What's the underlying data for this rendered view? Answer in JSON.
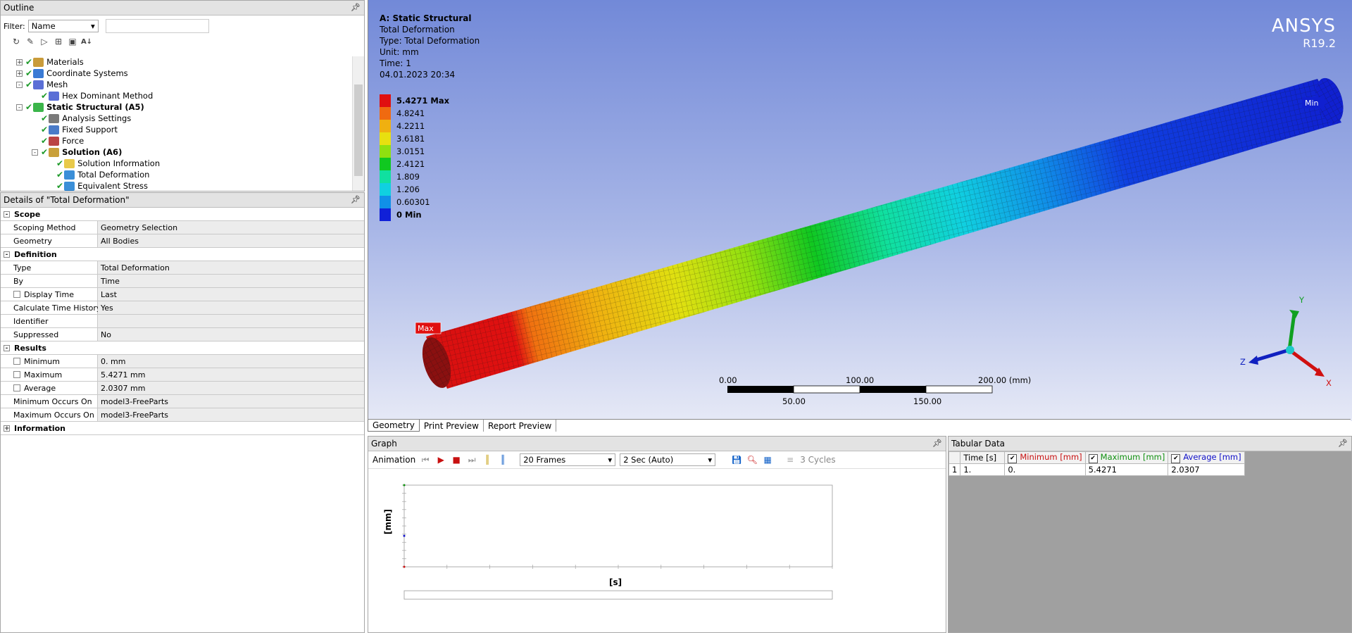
{
  "outline": {
    "title": "Outline",
    "filter_label": "Filter:",
    "filter_value": "Name",
    "items": [
      {
        "label": "Materials",
        "indent": 1,
        "expander": "+",
        "bold": false,
        "color": "#c99b3a"
      },
      {
        "label": "Coordinate Systems",
        "indent": 1,
        "expander": "+",
        "bold": false,
        "color": "#3a7bd5"
      },
      {
        "label": "Mesh",
        "indent": 1,
        "expander": "-",
        "bold": false,
        "color": "#5b6fd6"
      },
      {
        "label": "Hex Dominant Method",
        "indent": 2,
        "expander": "",
        "bold": false,
        "color": "#5b6fd6"
      },
      {
        "label": "Static Structural (A5)",
        "indent": 1,
        "expander": "-",
        "bold": true,
        "color": "#3bb54a"
      },
      {
        "label": "Analysis Settings",
        "indent": 2,
        "expander": "",
        "bold": false,
        "color": "#7a7a7a"
      },
      {
        "label": "Fixed Support",
        "indent": 2,
        "expander": "",
        "bold": false,
        "color": "#4a7bc8"
      },
      {
        "label": "Force",
        "indent": 2,
        "expander": "",
        "bold": false,
        "color": "#b44"
      },
      {
        "label": "Solution (A6)",
        "indent": 2,
        "expander": "-",
        "bold": true,
        "color": "#c9a03a"
      },
      {
        "label": "Solution Information",
        "indent": 3,
        "expander": "",
        "bold": false,
        "color": "#e8c94a"
      },
      {
        "label": "Total Deformation",
        "indent": 3,
        "expander": "",
        "bold": false,
        "color": "#3b8fd8"
      },
      {
        "label": "Equivalent Stress",
        "indent": 3,
        "expander": "",
        "bold": false,
        "color": "#3b8fd8"
      }
    ]
  },
  "details": {
    "title": "Details of \"Total Deformation\"",
    "rows": [
      {
        "type": "cat",
        "key": "Scope"
      },
      {
        "type": "row",
        "key": "Scoping Method",
        "value": "Geometry Selection"
      },
      {
        "type": "row",
        "key": "Geometry",
        "value": "All Bodies"
      },
      {
        "type": "cat",
        "key": "Definition"
      },
      {
        "type": "row",
        "key": "Type",
        "value": "Total Deformation"
      },
      {
        "type": "row",
        "key": "By",
        "value": "Time"
      },
      {
        "type": "rowc",
        "key": "Display Time",
        "value": "Last"
      },
      {
        "type": "row",
        "key": "Calculate Time History",
        "value": "Yes"
      },
      {
        "type": "row",
        "key": "Identifier",
        "value": ""
      },
      {
        "type": "row",
        "key": "Suppressed",
        "value": "No"
      },
      {
        "type": "cat",
        "key": "Results"
      },
      {
        "type": "rowc",
        "key": "Minimum",
        "value": "0. mm"
      },
      {
        "type": "rowc",
        "key": "Maximum",
        "value": "5.4271 mm"
      },
      {
        "type": "rowc",
        "key": "Average",
        "value": "2.0307 mm"
      },
      {
        "type": "row",
        "key": "Minimum Occurs On",
        "value": "model3-FreeParts"
      },
      {
        "type": "row",
        "key": "Maximum Occurs On",
        "value": "model3-FreeParts"
      },
      {
        "type": "cat",
        "key": "Information"
      }
    ]
  },
  "viewport": {
    "title": "A: Static Structural",
    "lines": [
      "Total Deformation",
      "Type: Total Deformation",
      "Unit: mm",
      "Time: 1",
      "04.01.2023 20:34"
    ],
    "legend": [
      {
        "label": "5.4271 Max",
        "color": "#e01010",
        "bold": true
      },
      {
        "label": "4.8241",
        "color": "#f06a10",
        "bold": false
      },
      {
        "label": "4.2211",
        "color": "#f0b010",
        "bold": false
      },
      {
        "label": "3.6181",
        "color": "#e8e010",
        "bold": false
      },
      {
        "label": "3.0151",
        "color": "#90e010",
        "bold": false
      },
      {
        "label": "2.4121",
        "color": "#10c820",
        "bold": false
      },
      {
        "label": "1.809",
        "color": "#10e0a0",
        "bold": false
      },
      {
        "label": "1.206",
        "color": "#10d0e0",
        "bold": false
      },
      {
        "label": "0.60301",
        "color": "#1090e8",
        "bold": false
      },
      {
        "label": "0 Min",
        "color": "#1020d8",
        "bold": true
      }
    ],
    "brand": "ANSYS",
    "version": "R19.2",
    "max_label": "Max",
    "min_label": "Min",
    "scale": {
      "t0": "0.00",
      "t100": "100.00",
      "t200": "200.00 (mm)",
      "t50": "50.00",
      "t150": "150.00"
    },
    "axes": {
      "x": "X",
      "y": "Y",
      "z": "Z"
    }
  },
  "view_tabs": [
    "Geometry",
    "Print Preview",
    "Report Preview"
  ],
  "graph": {
    "title": "Graph",
    "animation_label": "Animation",
    "frames": "20 Frames",
    "duration": "2 Sec (Auto)",
    "cycles": "3 Cycles",
    "ylabel": "[mm]",
    "xlabel": "[s]"
  },
  "tabular": {
    "title": "Tabular Data",
    "headers": [
      "Time [s]",
      "Minimum [mm]",
      "Maximum [mm]",
      "Average [mm]"
    ],
    "header_colors": [
      "#000000",
      "#c81010",
      "#109010",
      "#1010c8"
    ],
    "rows": [
      [
        "1",
        "1.",
        "0.",
        "5.4271",
        "2.0307"
      ]
    ]
  }
}
